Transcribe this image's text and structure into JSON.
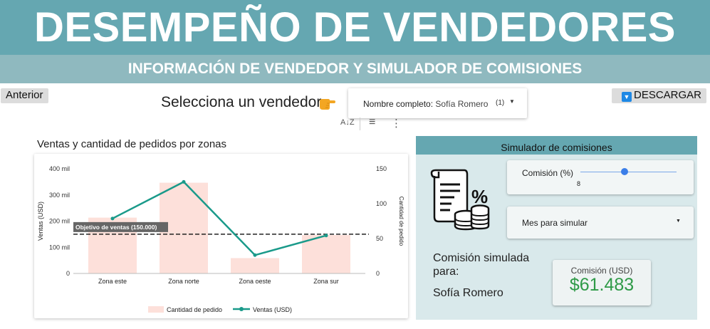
{
  "header": {
    "title": "DESEMPEÑO DE VENDEDORES",
    "subtitle": "INFORMACIÓN DE VENDEDOR Y SIMULADOR DE COMISIONES"
  },
  "nav": {
    "prev_label": "Anterior",
    "download_label": "DESCARGAR",
    "download_icon": "download-icon"
  },
  "selector": {
    "prompt": "Selecciona un vendedor",
    "prompt_icon": "pointing-hand-icon",
    "filter_label": "Nombre completo",
    "filter_value": "Sofía Romero",
    "filter_count": "(1)"
  },
  "toolbar": {
    "sort_icon": "A↓Z",
    "filter_icon": "≡",
    "more_icon": "⋮"
  },
  "chart": {
    "title": "Ventas y cantidad de pedidos por zonas"
  },
  "chart_data": {
    "type": "bar",
    "categories": [
      "Zona este",
      "Zona norte",
      "Zona oeste",
      "Zona sur"
    ],
    "series": [
      {
        "name": "Cantidad de pedido",
        "type": "bar",
        "axis": "right",
        "values": [
          80,
          130,
          22,
          55
        ]
      },
      {
        "name": "Ventas (USD)",
        "type": "line",
        "axis": "left",
        "values": [
          210000,
          350000,
          70000,
          145000
        ]
      }
    ],
    "ylabel_left": "Ventas (USD)",
    "ylabel_right": "Cantidad de pedido",
    "ylim_left": [
      0,
      400000
    ],
    "ylim_right": [
      0,
      150
    ],
    "yticks_left": [
      "0",
      "100 mil",
      "200 mil",
      "300 mil",
      "400 mil"
    ],
    "yticks_right": [
      "0",
      "50",
      "100",
      "150"
    ],
    "reference_line": {
      "label": "Objetivo de ventas (150.000)",
      "value": 150000
    },
    "legend_position": "bottom",
    "colors": {
      "bar": "#fde0da",
      "line": "#1a9a8a"
    }
  },
  "simulator": {
    "title": "Simulador de comisiones",
    "icon": "document-percent-coins-icon",
    "slider_label": "Comisión (%)",
    "slider_value": "8",
    "slider_fraction": 0.46,
    "month_label": "Mes para simular",
    "result_text": "Comisión simulada para:",
    "result_name": "Sofía Romero",
    "kpi_label": "Comisión (USD)",
    "kpi_value": "$61.483"
  }
}
